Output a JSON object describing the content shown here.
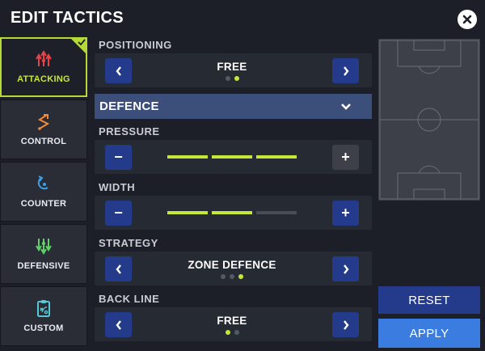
{
  "header": {
    "title": "EDIT TACTICS",
    "close_icon": "close-icon"
  },
  "sidebar": {
    "items": [
      {
        "label": "ATTACKING",
        "icon": "attacking-arrows-icon",
        "selected": true
      },
      {
        "label": "CONTROL",
        "icon": "control-zigzag-icon",
        "selected": false
      },
      {
        "label": "COUNTER",
        "icon": "counter-arrow-icon",
        "selected": false
      },
      {
        "label": "DEFENSIVE",
        "icon": "defensive-arrows-icon",
        "selected": false
      },
      {
        "label": "CUSTOM",
        "icon": "clipboard-icon",
        "selected": false
      }
    ]
  },
  "settings": {
    "positioning": {
      "label": "POSITIONING",
      "value": "FREE",
      "options_count": 2,
      "selected_index": 1
    },
    "defence": {
      "header": "DEFENCE"
    },
    "pressure": {
      "label": "PRESSURE",
      "level": 3,
      "max": 3
    },
    "width": {
      "label": "WIDTH",
      "level": 2,
      "max": 3
    },
    "strategy": {
      "label": "STRATEGY",
      "value": "ZONE DEFENCE",
      "options_count": 3,
      "selected_index": 2
    },
    "back_line": {
      "label": "BACK LINE",
      "value": "FREE",
      "options_count": 2,
      "selected_index": 0
    }
  },
  "actions": {
    "reset": "RESET",
    "apply": "APPLY"
  },
  "colors": {
    "accent": "#c6e63a",
    "button_blue": "#243a8a",
    "apply_blue": "#3a7ce0",
    "attacking_red": "#e8434a",
    "control_orange": "#f08a3c",
    "counter_blue": "#3aa0e8",
    "defensive_green": "#5fd06a",
    "custom_cyan": "#57c8d6"
  }
}
